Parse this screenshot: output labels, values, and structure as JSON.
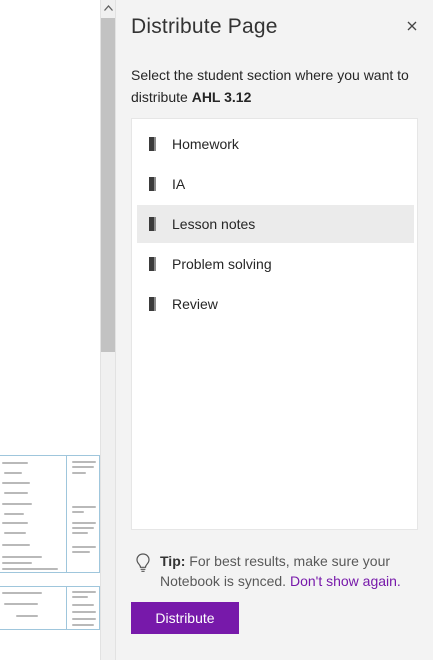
{
  "dialog": {
    "title": "Distribute Page",
    "close_label": "×",
    "instruction_prefix": "Select the student section where you want to distribute ",
    "page_name": "AHL 3.12"
  },
  "sections": [
    {
      "label": "Homework",
      "icon": "section-tab-icon"
    },
    {
      "label": "IA",
      "icon": "section-tab-icon"
    },
    {
      "label": "Lesson notes",
      "icon": "section-tab-icon",
      "highlighted": true
    },
    {
      "label": "Problem solving",
      "icon": "section-tab-icon"
    },
    {
      "label": "Review",
      "icon": "section-tab-icon"
    }
  ],
  "tip": {
    "lead": "Tip:",
    "text": " For best results, make sure your Notebook is synced. ",
    "link": "Don't show again."
  },
  "actions": {
    "distribute_label": "Distribute"
  },
  "colors": {
    "accent": "#7719aa",
    "panel_bg": "#f3f3f3",
    "hover_bg": "#ebebeb"
  }
}
